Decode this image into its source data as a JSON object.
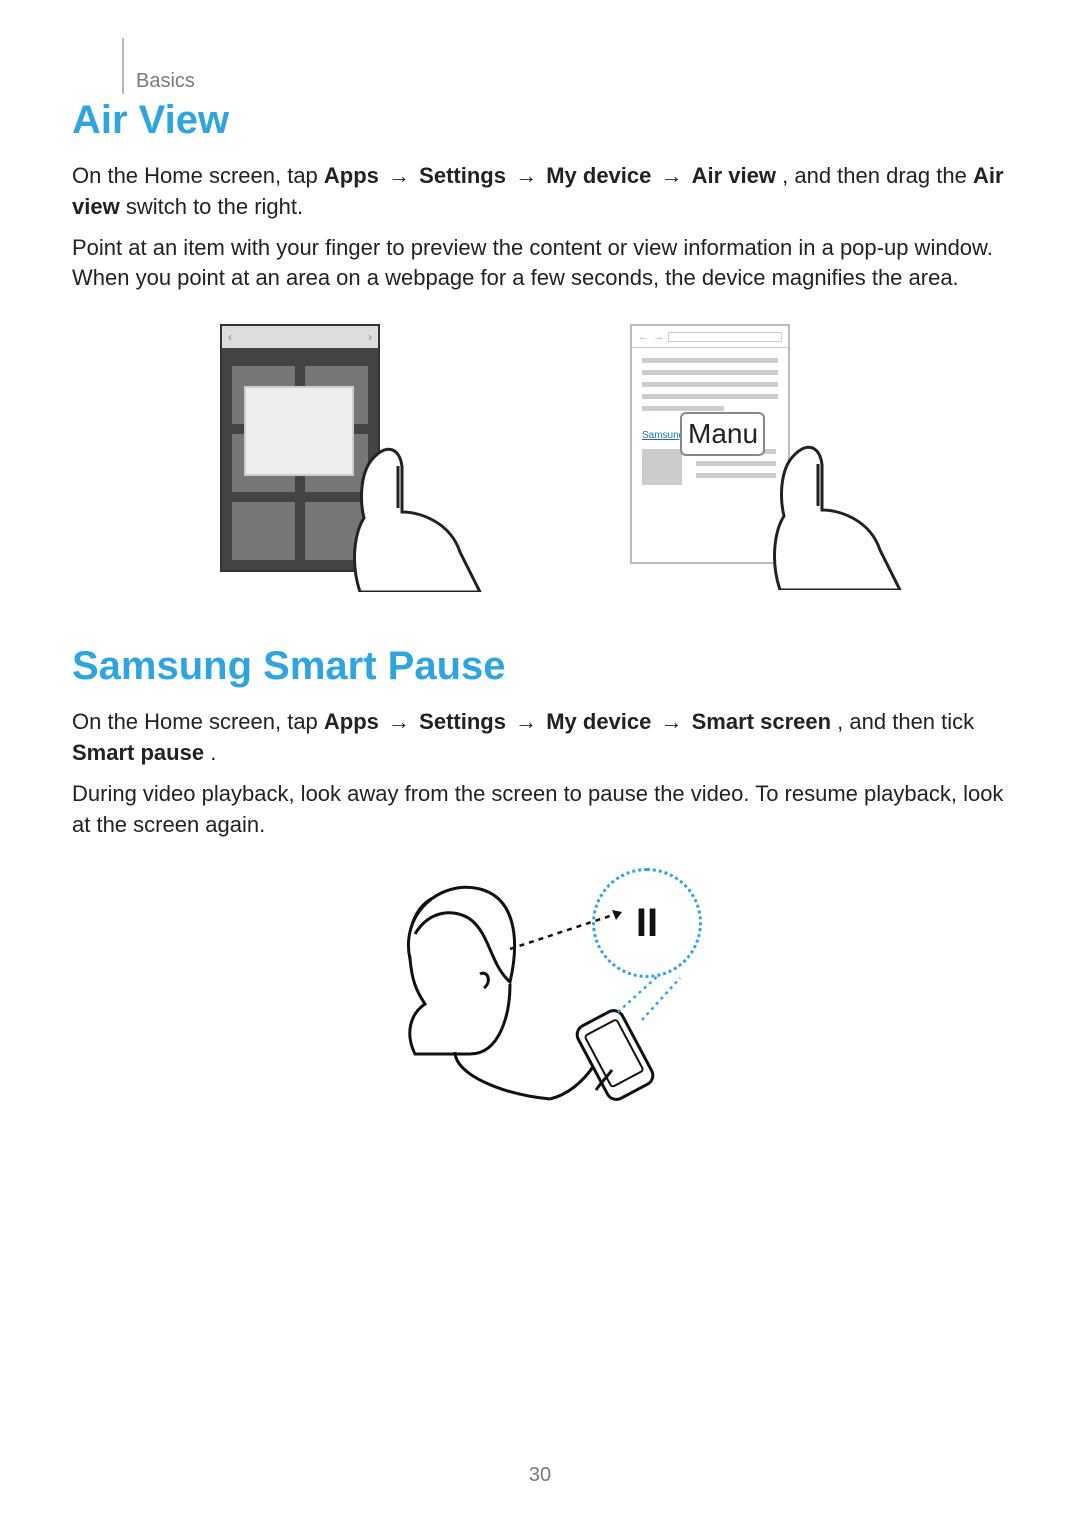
{
  "header": {
    "section": "Basics"
  },
  "air_view": {
    "heading": "Air View",
    "intro_prefix": "On the Home screen, tap ",
    "path_apps": "Apps",
    "path_settings": "Settings",
    "path_mydevice": "My device",
    "path_airview": "Air view",
    "intro_mid": ", and then drag the ",
    "path_airview_switch": "Air view",
    "intro_suffix": " switch to the right.",
    "desc": "Point at an item with your finger to preview the content or view information in a pop-up window. When you point at an area on a webpage for a few seconds, the device magnifies the area."
  },
  "browser_fig": {
    "magnified_text": "Manu",
    "link_text": "Samsung User Man"
  },
  "smart_pause": {
    "heading": "Samsung Smart Pause",
    "intro_prefix": "On the Home screen, tap ",
    "path_apps": "Apps",
    "path_settings": "Settings",
    "path_mydevice": "My device",
    "path_smartscreen": "Smart screen",
    "intro_mid": ", and then tick ",
    "path_smartpause": "Smart pause",
    "intro_suffix": ".",
    "desc": "During video playback, look away from the screen to pause the video. To resume playback, look at the screen again.",
    "pause_glyph": "II"
  },
  "page_number": "30",
  "arrow_glyph": "→"
}
